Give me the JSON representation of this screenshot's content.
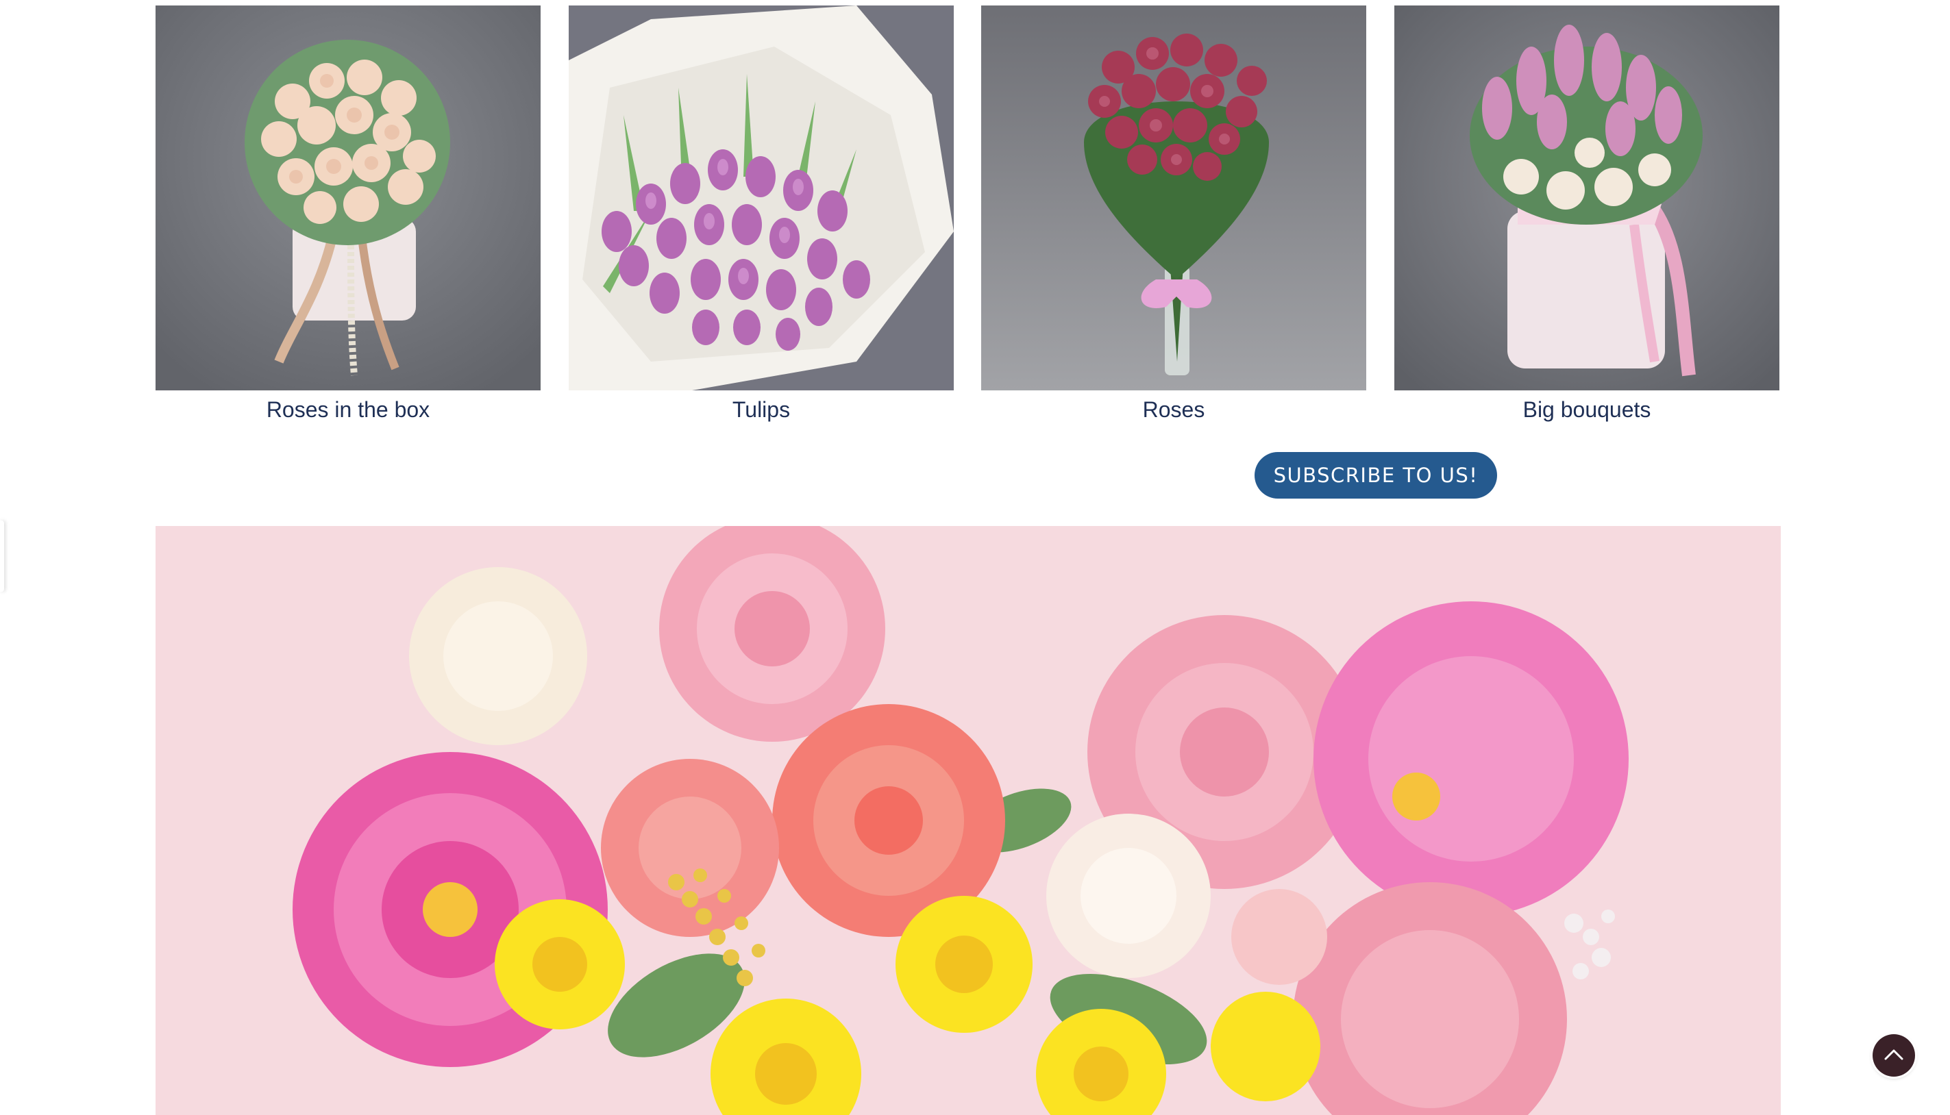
{
  "categories": [
    {
      "label": "Roses in the box",
      "icon": "roses-in-box-photo"
    },
    {
      "label": "Tulips",
      "icon": "tulips-bouquet-photo"
    },
    {
      "label": "Roses",
      "icon": "roses-bouquet-photo"
    },
    {
      "label": "Big bouquets",
      "icon": "big-bouquet-photo"
    }
  ],
  "subscribe": {
    "label": "SUBSCRIBE TO US!"
  },
  "hero": {
    "icon": "mixed-flowers-banner-image"
  },
  "back_to_top": {
    "icon": "chevron-up-icon"
  },
  "colors": {
    "text": "#1e2f55",
    "button": "#255a8f",
    "hero_background": "#f6dadf",
    "back_to_top": "#3a2128"
  }
}
